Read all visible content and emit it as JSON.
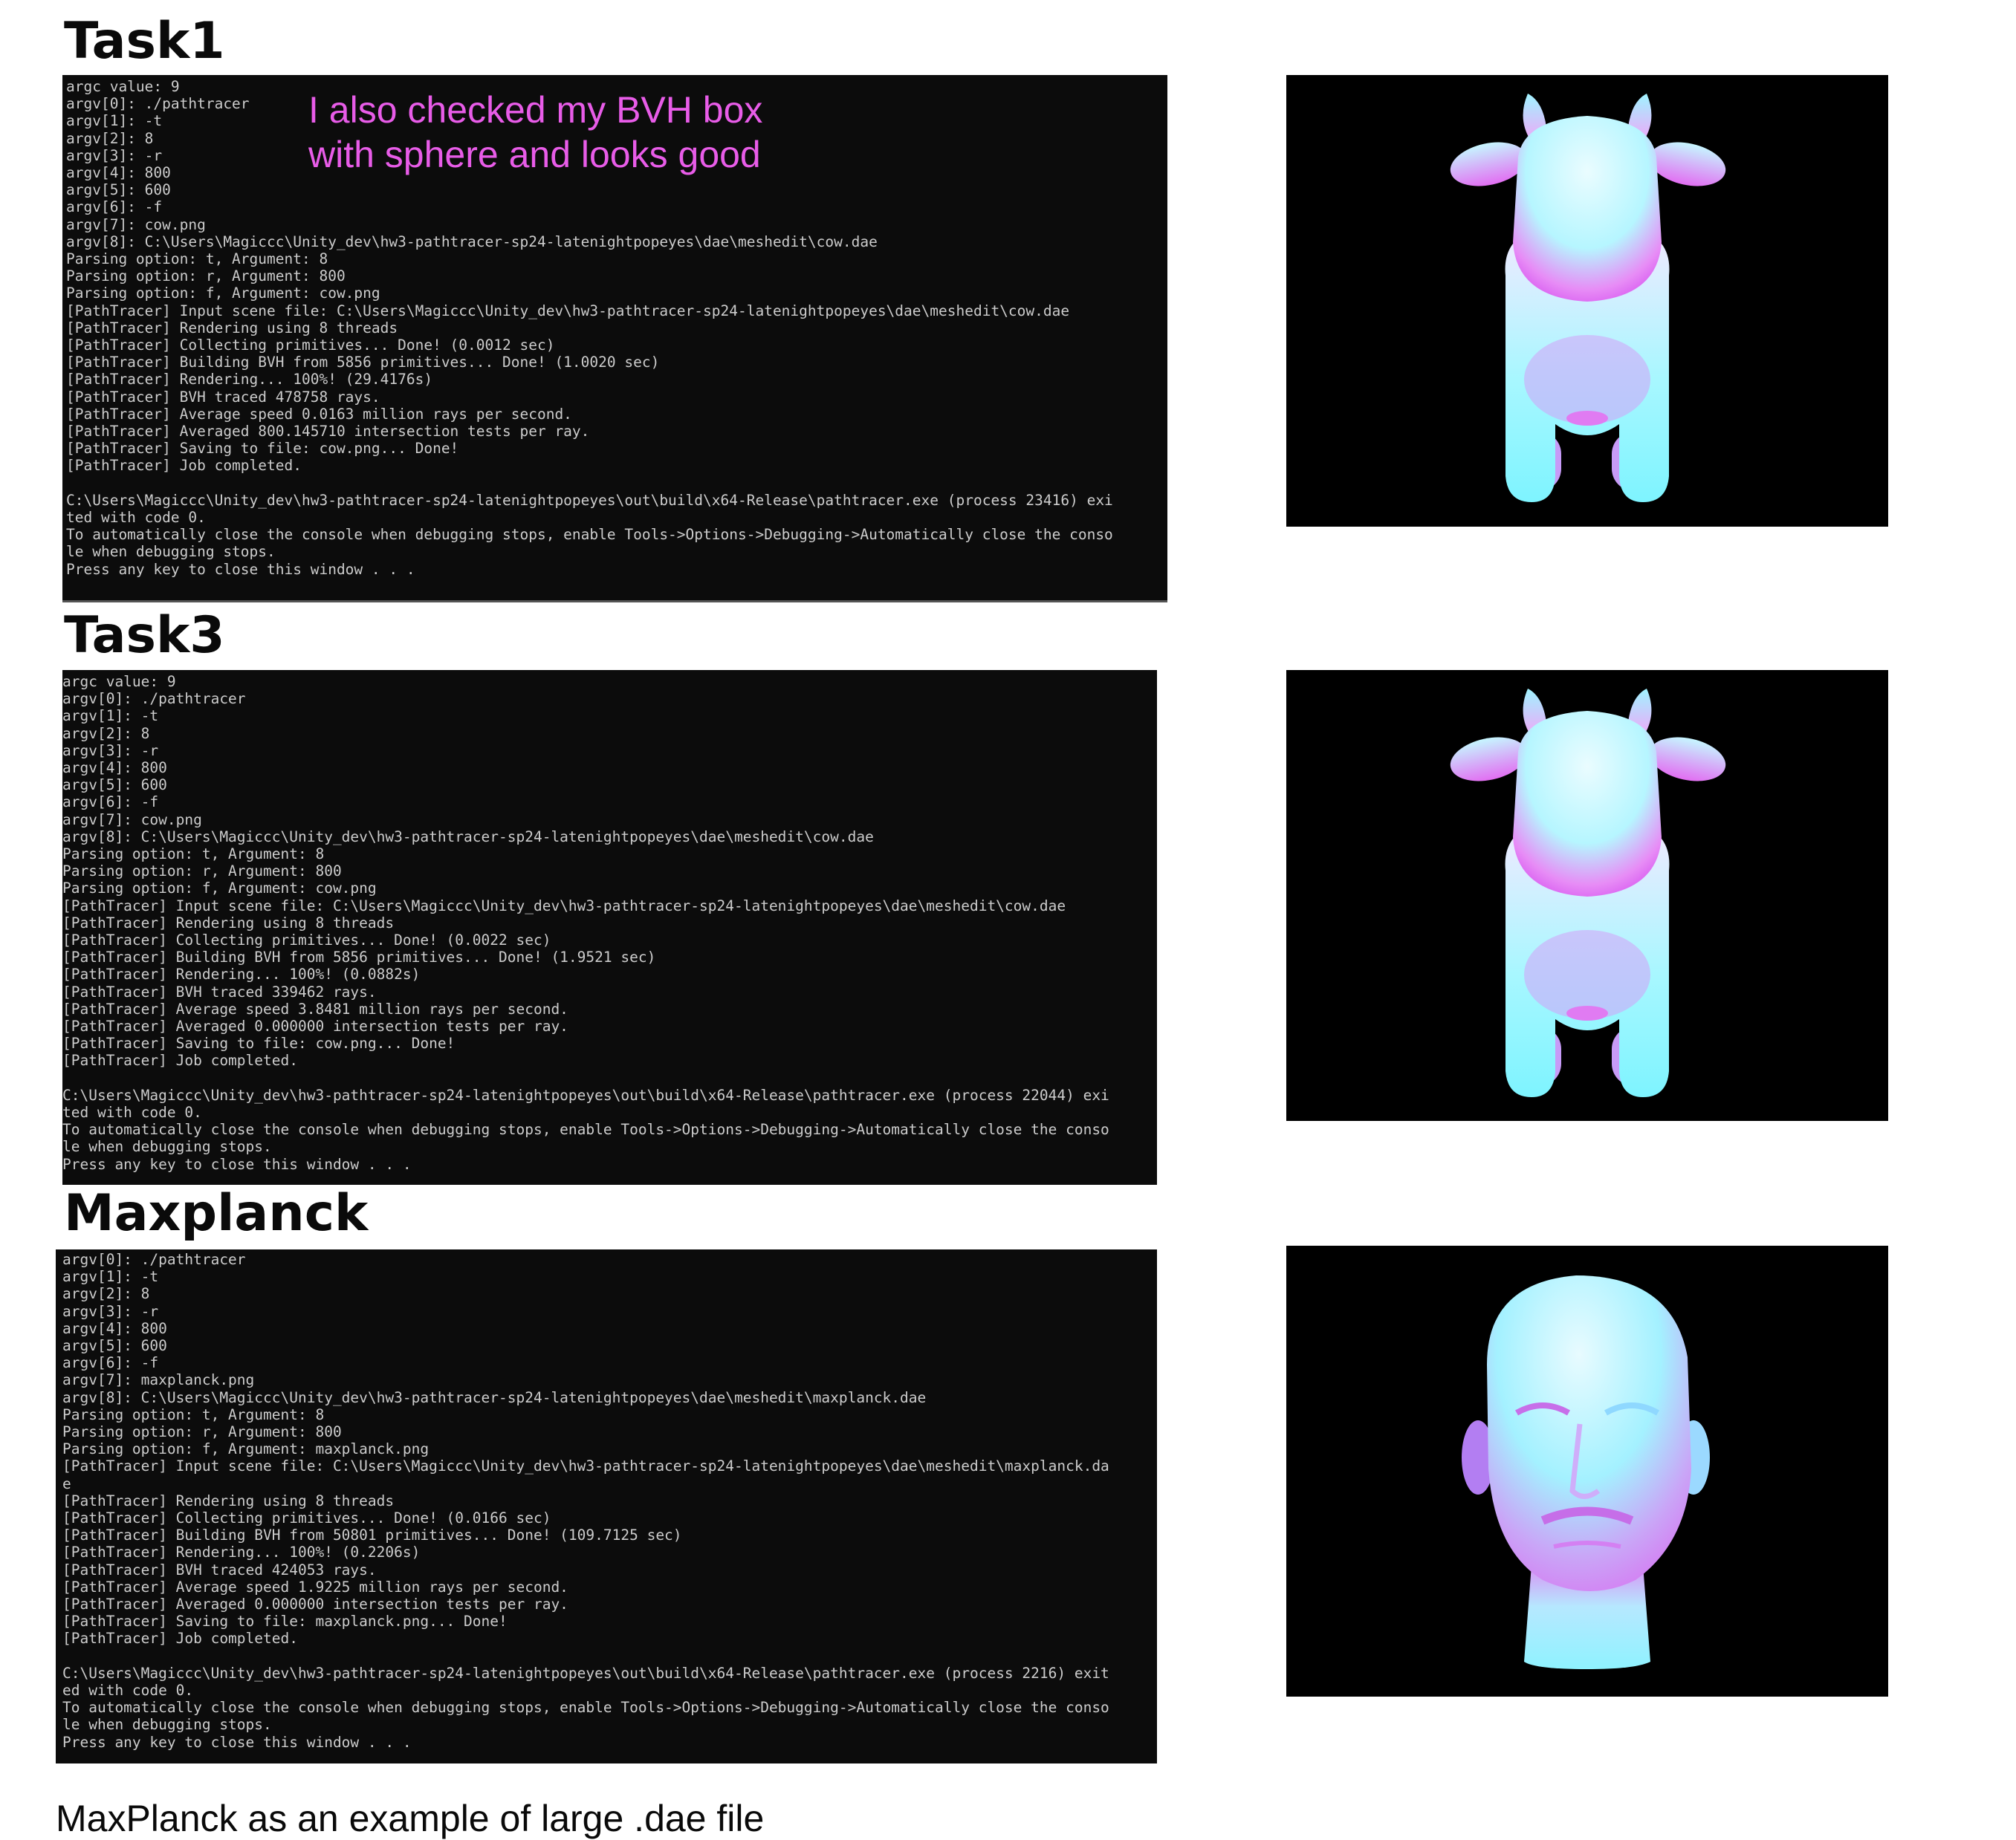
{
  "sections": {
    "task1": {
      "heading": "Task1",
      "note_line1": "I also checked my BVH box",
      "note_line2": "with sphere and looks good",
      "console_lines": [
        "argc value: 9",
        "argv[0]: ./pathtracer",
        "argv[1]: -t",
        "argv[2]: 8",
        "argv[3]: -r",
        "argv[4]: 800",
        "argv[5]: 600",
        "argv[6]: -f",
        "argv[7]: cow.png",
        "argv[8]: C:\\Users\\Magiccc\\Unity_dev\\hw3-pathtracer-sp24-latenightpopeyes\\dae\\meshedit\\cow.dae",
        "Parsing option: t, Argument: 8",
        "Parsing option: r, Argument: 800",
        "Parsing option: f, Argument: cow.png",
        "[PathTracer] Input scene file: C:\\Users\\Magiccc\\Unity_dev\\hw3-pathtracer-sp24-latenightpopeyes\\dae\\meshedit\\cow.dae",
        "[PathTracer] Rendering using 8 threads",
        "[PathTracer] Collecting primitives... Done! (0.0012 sec)",
        "[PathTracer] Building BVH from 5856 primitives... Done! (1.0020 sec)",
        "[PathTracer] Rendering... 100%! (29.4176s)",
        "[PathTracer] BVH traced 478758 rays.",
        "[PathTracer] Average speed 0.0163 million rays per second.",
        "[PathTracer] Averaged 800.145710 intersection tests per ray.",
        "[PathTracer] Saving to file: cow.png... Done!",
        "[PathTracer] Job completed.",
        "",
        "C:\\Users\\Magiccc\\Unity_dev\\hw3-pathtracer-sp24-latenightpopeyes\\out\\build\\x64-Release\\pathtracer.exe (process 23416) exi",
        "ted with code 0.",
        "To automatically close the console when debugging stops, enable Tools->Options->Debugging->Automatically close the conso",
        "le when debugging stops.",
        "Press any key to close this window . . ."
      ]
    },
    "task3": {
      "heading": "Task3",
      "console_lines": [
        "argc value: 9",
        "argv[0]: ./pathtracer",
        "argv[1]: -t",
        "argv[2]: 8",
        "argv[3]: -r",
        "argv[4]: 800",
        "argv[5]: 600",
        "argv[6]: -f",
        "argv[7]: cow.png",
        "argv[8]: C:\\Users\\Magiccc\\Unity_dev\\hw3-pathtracer-sp24-latenightpopeyes\\dae\\meshedit\\cow.dae",
        "Parsing option: t, Argument: 8",
        "Parsing option: r, Argument: 800",
        "Parsing option: f, Argument: cow.png",
        "[PathTracer] Input scene file: C:\\Users\\Magiccc\\Unity_dev\\hw3-pathtracer-sp24-latenightpopeyes\\dae\\meshedit\\cow.dae",
        "[PathTracer] Rendering using 8 threads",
        "[PathTracer] Collecting primitives... Done! (0.0022 sec)",
        "[PathTracer] Building BVH from 5856 primitives... Done! (1.9521 sec)",
        "[PathTracer] Rendering... 100%! (0.0882s)",
        "[PathTracer] BVH traced 339462 rays.",
        "[PathTracer] Average speed 3.8481 million rays per second.",
        "[PathTracer] Averaged 0.000000 intersection tests per ray.",
        "[PathTracer] Saving to file: cow.png... Done!",
        "[PathTracer] Job completed.",
        "",
        "C:\\Users\\Magiccc\\Unity_dev\\hw3-pathtracer-sp24-latenightpopeyes\\out\\build\\x64-Release\\pathtracer.exe (process 22044) exi",
        "ted with code 0.",
        "To automatically close the console when debugging stops, enable Tools->Options->Debugging->Automatically close the conso",
        "le when debugging stops.",
        "Press any key to close this window . . ."
      ]
    },
    "maxplanck": {
      "heading": "Maxplanck",
      "console_lines": [
        "argv[0]: ./pathtracer",
        "argv[1]: -t",
        "argv[2]: 8",
        "argv[3]: -r",
        "argv[4]: 800",
        "argv[5]: 600",
        "argv[6]: -f",
        "argv[7]: maxplanck.png",
        "argv[8]: C:\\Users\\Magiccc\\Unity_dev\\hw3-pathtracer-sp24-latenightpopeyes\\dae\\meshedit\\maxplanck.dae",
        "Parsing option: t, Argument: 8",
        "Parsing option: r, Argument: 800",
        "Parsing option: f, Argument: maxplanck.png",
        "[PathTracer] Input scene file: C:\\Users\\Magiccc\\Unity_dev\\hw3-pathtracer-sp24-latenightpopeyes\\dae\\meshedit\\maxplanck.da",
        "e",
        "[PathTracer] Rendering using 8 threads",
        "[PathTracer] Collecting primitives... Done! (0.0166 sec)",
        "[PathTracer] Building BVH from 50801 primitives... Done! (109.7125 sec)",
        "[PathTracer] Rendering... 100%! (0.2206s)",
        "[PathTracer] BVH traced 424053 rays.",
        "[PathTracer] Average speed 1.9225 million rays per second.",
        "[PathTracer] Averaged 0.000000 intersection tests per ray.",
        "[PathTracer] Saving to file: maxplanck.png... Done!",
        "[PathTracer] Job completed.",
        "",
        "C:\\Users\\Magiccc\\Unity_dev\\hw3-pathtracer-sp24-latenightpopeyes\\out\\build\\x64-Release\\pathtracer.exe (process 2216) exit",
        "ed with code 0.",
        "To automatically close the console when debugging stops, enable Tools->Options->Debugging->Automatically close the conso",
        "le when debugging stops.",
        "Press any key to close this window . . ."
      ]
    }
  },
  "caption": "MaxPlanck as an example of large .dae file",
  "colors": {
    "console_bg": "#0c0c0c",
    "console_text": "#cccccc",
    "note_text": "#e85ce8",
    "render_bg": "#000000",
    "normal_cyan": "#7ff6ff",
    "normal_magenta": "#f06bf6"
  },
  "images": {
    "task1_render": "cow-normal-render",
    "task3_render": "cow-normal-render",
    "maxplanck_render": "maxplanck-head-normal-render"
  }
}
